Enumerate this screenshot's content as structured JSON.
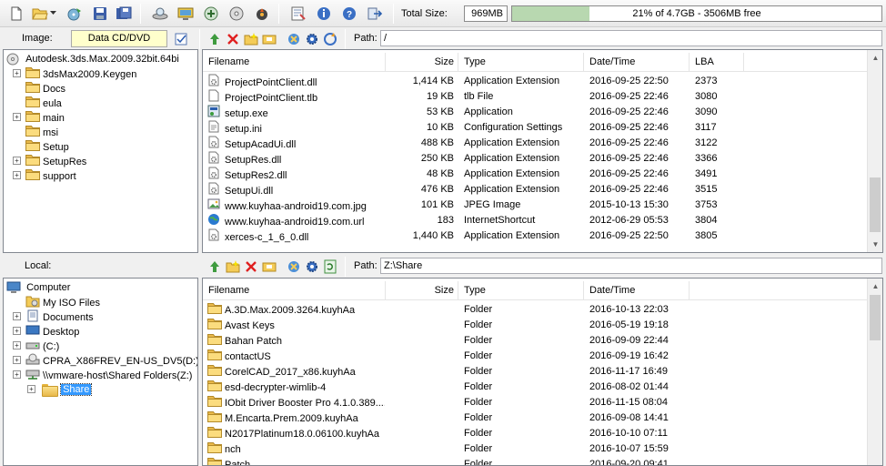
{
  "toolbar": {
    "total_size_label": "Total Size:",
    "total_size_value": "969MB",
    "capacity_text": "21% of 4.7GB - 3506MB free",
    "capacity_fraction": 0.21,
    "icons": [
      "new-icon",
      "open-icon",
      "dropdown-icon",
      "burn-icon",
      "save-icon",
      "save-as-icon",
      "mount-icon",
      "monitor-icon",
      "compress-icon",
      "make-image-icon",
      "tools-icon",
      "properties-icon",
      "info-icon",
      "help-icon",
      "exit-icon"
    ]
  },
  "image_bar": {
    "label": "Image:",
    "type_value": "Data CD/DVD",
    "path_label": "Path:",
    "path_value": "/"
  },
  "local_bar": {
    "label": "Local:",
    "path_label": "Path:",
    "path_value": "Z:\\Share"
  },
  "image_tree": {
    "root": "Autodesk.3ds.Max.2009.32bit.64bi",
    "items": [
      {
        "label": "3dsMax2009.Keygen",
        "expandable": true
      },
      {
        "label": "Docs",
        "expandable": false
      },
      {
        "label": "eula",
        "expandable": false
      },
      {
        "label": "main",
        "expandable": true
      },
      {
        "label": "msi",
        "expandable": false
      },
      {
        "label": "Setup",
        "expandable": false
      },
      {
        "label": "SetupRes",
        "expandable": true
      },
      {
        "label": "support",
        "expandable": true
      }
    ]
  },
  "image_columns": [
    "Filename",
    "Size",
    "Type",
    "Date/Time",
    "LBA"
  ],
  "image_files": [
    {
      "name": "ProjectPointClient.dll",
      "size": "1,414 KB",
      "type": "Application Extension",
      "date": "2016-09-25 22:50",
      "lba": "2373",
      "icon": "dll"
    },
    {
      "name": "ProjectPointClient.tlb",
      "size": "19 KB",
      "type": "tlb File",
      "date": "2016-09-25 22:46",
      "lba": "3080",
      "icon": "file"
    },
    {
      "name": "setup.exe",
      "size": "53 KB",
      "type": "Application",
      "date": "2016-09-25 22:46",
      "lba": "3090",
      "icon": "exe"
    },
    {
      "name": "setup.ini",
      "size": "10 KB",
      "type": "Configuration Settings",
      "date": "2016-09-25 22:46",
      "lba": "3117",
      "icon": "ini"
    },
    {
      "name": "SetupAcadUi.dll",
      "size": "488 KB",
      "type": "Application Extension",
      "date": "2016-09-25 22:46",
      "lba": "3122",
      "icon": "dll"
    },
    {
      "name": "SetupRes.dll",
      "size": "250 KB",
      "type": "Application Extension",
      "date": "2016-09-25 22:46",
      "lba": "3366",
      "icon": "dll"
    },
    {
      "name": "SetupRes2.dll",
      "size": "48 KB",
      "type": "Application Extension",
      "date": "2016-09-25 22:46",
      "lba": "3491",
      "icon": "dll"
    },
    {
      "name": "SetupUi.dll",
      "size": "476 KB",
      "type": "Application Extension",
      "date": "2016-09-25 22:46",
      "lba": "3515",
      "icon": "dll"
    },
    {
      "name": "www.kuyhaa-android19.com.jpg",
      "size": "101 KB",
      "type": "JPEG Image",
      "date": "2015-10-13 15:30",
      "lba": "3753",
      "icon": "jpg"
    },
    {
      "name": "www.kuyhaa-android19.com.url",
      "size": "183",
      "type": "InternetShortcut",
      "date": "2012-06-29 05:53",
      "lba": "3804",
      "icon": "url"
    },
    {
      "name": "xerces-c_1_6_0.dll",
      "size": "1,440 KB",
      "type": "Application Extension",
      "date": "2016-09-25 22:50",
      "lba": "3805",
      "icon": "dll"
    }
  ],
  "local_tree": {
    "root": "Computer",
    "items": [
      {
        "label": "My ISO Files",
        "expandable": false,
        "icon": "iso"
      },
      {
        "label": "Documents",
        "expandable": true,
        "icon": "docs"
      },
      {
        "label": "Desktop",
        "expandable": true,
        "icon": "desktop"
      },
      {
        "label": "(C:)",
        "expandable": true,
        "icon": "drive"
      },
      {
        "label": "CPRA_X86FREV_EN-US_DV5(D:)",
        "expandable": true,
        "icon": "cd"
      },
      {
        "label": "\\\\vmware-host\\Shared Folders(Z:)",
        "expandable": true,
        "icon": "netdrive"
      }
    ],
    "selected": "Share"
  },
  "local_columns": [
    "Filename",
    "Size",
    "Type",
    "Date/Time"
  ],
  "local_files": [
    {
      "name": "A.3D.Max.2009.3264.kuyhAa",
      "type": "Folder",
      "date": "2016-10-13 22:03"
    },
    {
      "name": "Avast Keys",
      "type": "Folder",
      "date": "2016-05-19 19:18"
    },
    {
      "name": "Bahan Patch",
      "type": "Folder",
      "date": "2016-09-09 22:44"
    },
    {
      "name": "contactUS",
      "type": "Folder",
      "date": "2016-09-19 16:42"
    },
    {
      "name": "CorelCAD_2017_x86.kuyhAa",
      "type": "Folder",
      "date": "2016-11-17 16:49"
    },
    {
      "name": "esd-decrypter-wimlib-4",
      "type": "Folder",
      "date": "2016-08-02 01:44"
    },
    {
      "name": "IObit Driver Booster Pro 4.1.0.389....",
      "type": "Folder",
      "date": "2016-11-15 08:04"
    },
    {
      "name": "M.Encarta.Prem.2009.kuyhAa",
      "type": "Folder",
      "date": "2016-09-08 14:41"
    },
    {
      "name": "N2017Platinum18.0.06100.kuyhAa",
      "type": "Folder",
      "date": "2016-10-10 07:11"
    },
    {
      "name": "nch",
      "type": "Folder",
      "date": "2016-10-07 15:59"
    },
    {
      "name": "Patch",
      "type": "Folder",
      "date": "2016-09-20 09:41"
    }
  ],
  "colors": {
    "accent": "#3399ff",
    "capacity_fill": "#b8d8b0",
    "folder": "#f2c857"
  }
}
